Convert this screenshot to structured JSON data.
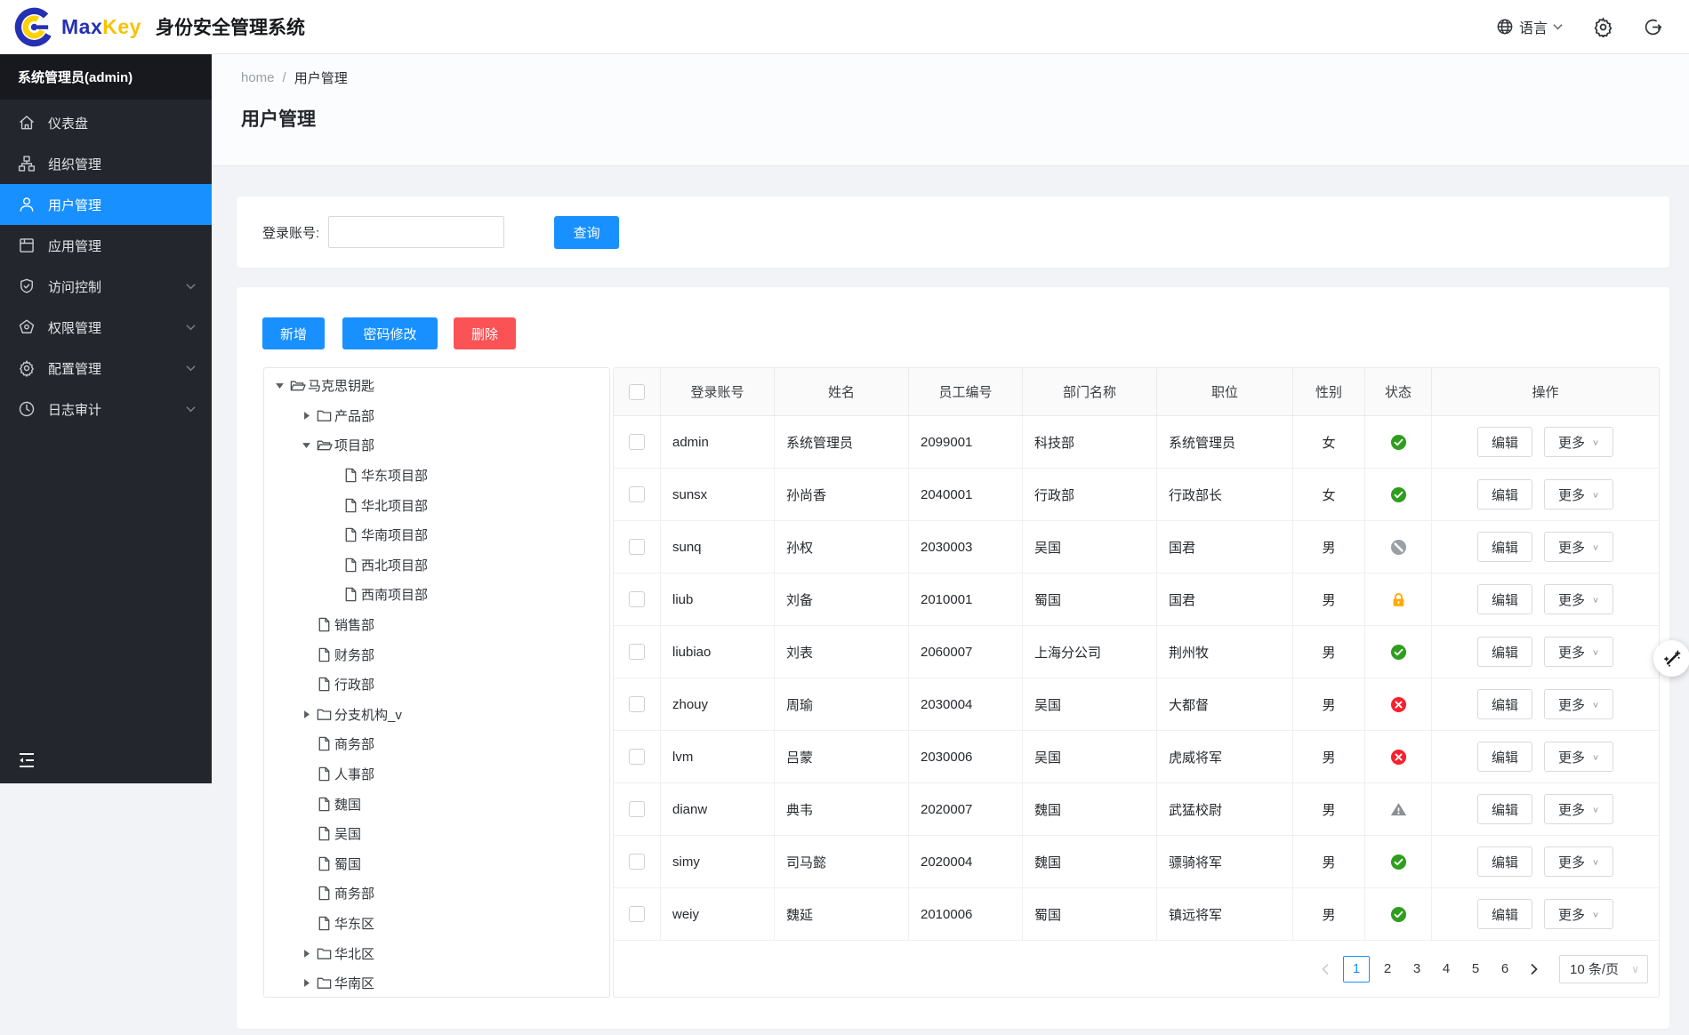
{
  "header": {
    "brand_max": "Max",
    "brand_key": "Key",
    "app_title": "身份安全管理系统",
    "lang_label": "语言"
  },
  "sidebar": {
    "user": "系统管理员(admin)",
    "items": [
      {
        "label": "仪表盘",
        "icon": "dashboard",
        "active": false,
        "chevron": false
      },
      {
        "label": "组织管理",
        "icon": "organization",
        "active": false,
        "chevron": false
      },
      {
        "label": "用户管理",
        "icon": "user",
        "active": true,
        "chevron": false
      },
      {
        "label": "应用管理",
        "icon": "application",
        "active": false,
        "chevron": false
      },
      {
        "label": "访问控制",
        "icon": "access",
        "active": false,
        "chevron": true
      },
      {
        "label": "权限管理",
        "icon": "permission",
        "active": false,
        "chevron": true
      },
      {
        "label": "配置管理",
        "icon": "config",
        "active": false,
        "chevron": true
      },
      {
        "label": "日志审计",
        "icon": "audit",
        "active": false,
        "chevron": true
      }
    ]
  },
  "breadcrumb": {
    "home": "home",
    "separator": "/",
    "current": "用户管理"
  },
  "page": {
    "title": "用户管理"
  },
  "search": {
    "label": "登录账号:",
    "input_value": "",
    "query_button": "查询"
  },
  "toolbar": {
    "add": "新增",
    "change_password": "密码修改",
    "delete": "删除"
  },
  "tree": {
    "items": [
      {
        "label": "马克思钥匙",
        "level": 0,
        "icon": "folder-open",
        "toggle": "expanded"
      },
      {
        "label": "产品部",
        "level": 1,
        "icon": "folder-closed",
        "toggle": "collapsed"
      },
      {
        "label": "项目部",
        "level": 1,
        "icon": "folder-open",
        "toggle": "expanded"
      },
      {
        "label": "华东项目部",
        "level": 2,
        "icon": "file",
        "toggle": "leaf"
      },
      {
        "label": "华北项目部",
        "level": 2,
        "icon": "file",
        "toggle": "leaf"
      },
      {
        "label": "华南项目部",
        "level": 2,
        "icon": "file",
        "toggle": "leaf"
      },
      {
        "label": "西北项目部",
        "level": 2,
        "icon": "file",
        "toggle": "leaf"
      },
      {
        "label": "西南项目部",
        "level": 2,
        "icon": "file",
        "toggle": "leaf"
      },
      {
        "label": "销售部",
        "level": 1,
        "icon": "file",
        "toggle": "leaf"
      },
      {
        "label": "财务部",
        "level": 1,
        "icon": "file",
        "toggle": "leaf"
      },
      {
        "label": "行政部",
        "level": 1,
        "icon": "file",
        "toggle": "leaf"
      },
      {
        "label": "分支机构_v",
        "level": 1,
        "icon": "folder-closed",
        "toggle": "collapsed"
      },
      {
        "label": "商务部",
        "level": 1,
        "icon": "file",
        "toggle": "leaf"
      },
      {
        "label": "人事部",
        "level": 1,
        "icon": "file",
        "toggle": "leaf"
      },
      {
        "label": "魏国",
        "level": 1,
        "icon": "file",
        "toggle": "leaf"
      },
      {
        "label": "吴国",
        "level": 1,
        "icon": "file",
        "toggle": "leaf"
      },
      {
        "label": "蜀国",
        "level": 1,
        "icon": "file",
        "toggle": "leaf"
      },
      {
        "label": "商务部",
        "level": 1,
        "icon": "file",
        "toggle": "leaf"
      },
      {
        "label": "华东区",
        "level": 1,
        "icon": "file",
        "toggle": "leaf"
      },
      {
        "label": "华北区",
        "level": 1,
        "icon": "folder-closed",
        "toggle": "collapsed"
      },
      {
        "label": "华南区",
        "level": 1,
        "icon": "folder-closed",
        "toggle": "collapsed"
      }
    ]
  },
  "table": {
    "columns": [
      "登录账号",
      "姓名",
      "员工编号",
      "部门名称",
      "职位",
      "性别",
      "状态",
      "操作"
    ],
    "edit_label": "编辑",
    "more_label": "更多",
    "rows": [
      {
        "account": "admin",
        "name": "系统管理员",
        "employee_id": "2099001",
        "department": "科技部",
        "position": "系统管理员",
        "gender": "女",
        "status": "check"
      },
      {
        "account": "sunsx",
        "name": "孙尚香",
        "employee_id": "2040001",
        "department": "行政部",
        "position": "行政部长",
        "gender": "女",
        "status": "check"
      },
      {
        "account": "sunq",
        "name": "孙权",
        "employee_id": "2030003",
        "department": "吴国",
        "position": "国君",
        "gender": "男",
        "status": "ban"
      },
      {
        "account": "liub",
        "name": "刘备",
        "employee_id": "2010001",
        "department": "蜀国",
        "position": "国君",
        "gender": "男",
        "status": "lock"
      },
      {
        "account": "liubiao",
        "name": "刘表",
        "employee_id": "2060007",
        "department": "上海分公司",
        "position": "荆州牧",
        "gender": "男",
        "status": "check"
      },
      {
        "account": "zhouy",
        "name": "周瑜",
        "employee_id": "2030004",
        "department": "吴国",
        "position": "大都督",
        "gender": "男",
        "status": "cross"
      },
      {
        "account": "lvm",
        "name": "吕蒙",
        "employee_id": "2030006",
        "department": "吴国",
        "position": "虎威将军",
        "gender": "男",
        "status": "cross"
      },
      {
        "account": "dianw",
        "name": "典韦",
        "employee_id": "2020007",
        "department": "魏国",
        "position": "武猛校尉",
        "gender": "男",
        "status": "warn"
      },
      {
        "account": "simy",
        "name": "司马懿",
        "employee_id": "2020004",
        "department": "魏国",
        "position": "骠骑将军",
        "gender": "男",
        "status": "check"
      },
      {
        "account": "weiy",
        "name": "魏延",
        "employee_id": "2010006",
        "department": "蜀国",
        "position": "镇远将军",
        "gender": "男",
        "status": "check"
      }
    ]
  },
  "pagination": {
    "pages": [
      {
        "label": "1",
        "active": true
      },
      {
        "label": "2",
        "active": false
      },
      {
        "label": "3",
        "active": false
      },
      {
        "label": "4",
        "active": false
      },
      {
        "label": "5",
        "active": false
      },
      {
        "label": "6",
        "active": false
      }
    ],
    "page_size": "10 条/页"
  },
  "colors": {
    "primary": "#1890ff",
    "danger": "#fb5355",
    "status_active_green": "#2f9e1f",
    "status_inactive_red": "#f5222d",
    "status_locked_orange": "#ffaa00",
    "status_disabled_gray": "#9aa0a6",
    "status_warning_gray": "#8b9095",
    "sidebar_bg": "#23262c",
    "brand_blue": "#2531b2",
    "brand_yellow": "#f7c300"
  }
}
